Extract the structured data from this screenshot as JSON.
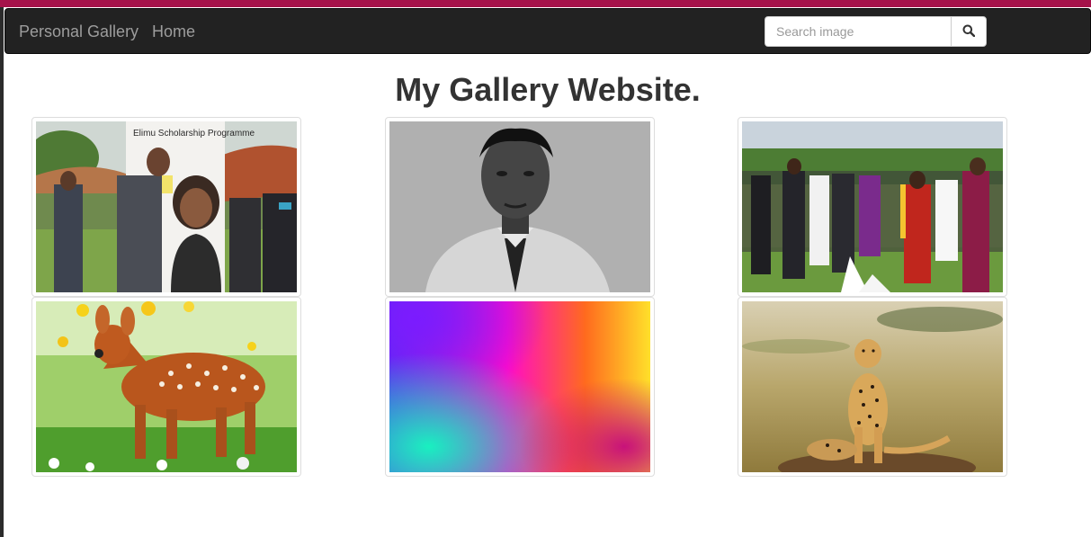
{
  "navbar": {
    "brand": "Personal Gallery",
    "links": [
      {
        "label": "Home"
      }
    ]
  },
  "search": {
    "placeholder": "Search image",
    "value": "",
    "button_icon": "search-icon"
  },
  "main": {
    "title": "My Gallery Website."
  },
  "gallery": {
    "images": [
      {
        "name": "scholarship-event-photo",
        "banner_text": "Elimu Scholarship Programme"
      },
      {
        "name": "portrait-photo"
      },
      {
        "name": "crowd-ceremony-photo"
      },
      {
        "name": "fawn-in-flowers-photo"
      },
      {
        "name": "colorful-gradient-photo"
      },
      {
        "name": "cheetah-photo"
      }
    ]
  },
  "colors": {
    "browser_accent": "#a5124a",
    "navbar_bg": "#222222",
    "navbar_text": "#9d9d9d",
    "title_text": "#333333"
  }
}
